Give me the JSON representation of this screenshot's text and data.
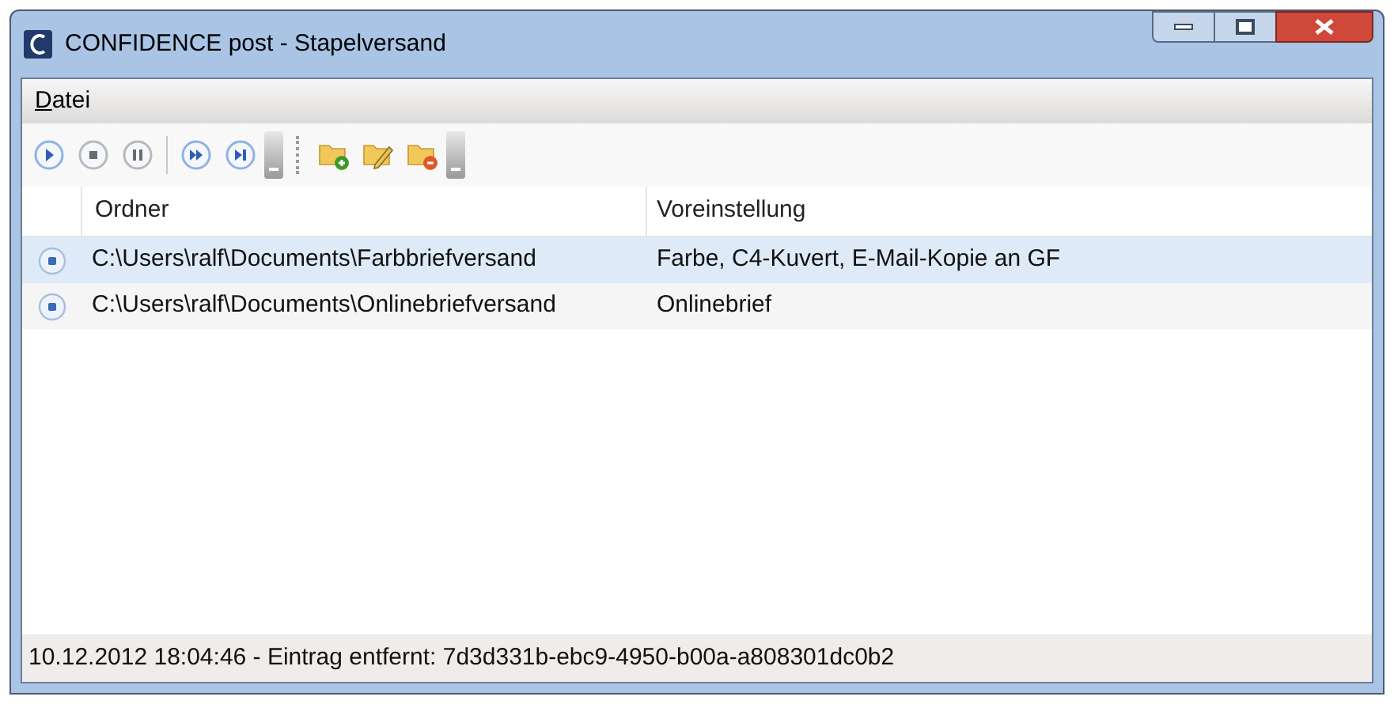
{
  "window": {
    "title": "CONFIDENCE post - Stapelversand"
  },
  "menu": [
    {
      "label": "Datei"
    }
  ],
  "toolbar": [
    {
      "kind": "play",
      "disabled": false
    },
    {
      "kind": "stop",
      "disabled": true
    },
    {
      "kind": "pause",
      "disabled": true
    },
    {
      "kind": "separator"
    },
    {
      "kind": "forward",
      "disabled": false
    },
    {
      "kind": "skip",
      "disabled": false
    },
    {
      "kind": "overflow"
    },
    {
      "kind": "grip"
    },
    {
      "kind": "folder-add",
      "disabled": false
    },
    {
      "kind": "folder-edit",
      "disabled": false
    },
    {
      "kind": "folder-remove",
      "disabled": false
    },
    {
      "kind": "overflow"
    }
  ],
  "table": {
    "columns": [
      "Ordner",
      "Voreinstellung"
    ],
    "rows": [
      {
        "cells": [
          "C:\\Users\\ralf\\Documents\\Farbbriefversand",
          "Farbe, C4-Kuvert, E-Mail-Kopie an GF"
        ],
        "selected": true
      },
      {
        "cells": [
          "C:\\Users\\ralf\\Documents\\Onlinebriefversand",
          "Onlinebrief"
        ],
        "selected": false
      }
    ]
  },
  "status_bar": "10.12.2012 18:04:46 - Eintrag entfernt: 7d3d331b-ebc9-4950-b00a-a808301dc0b2"
}
